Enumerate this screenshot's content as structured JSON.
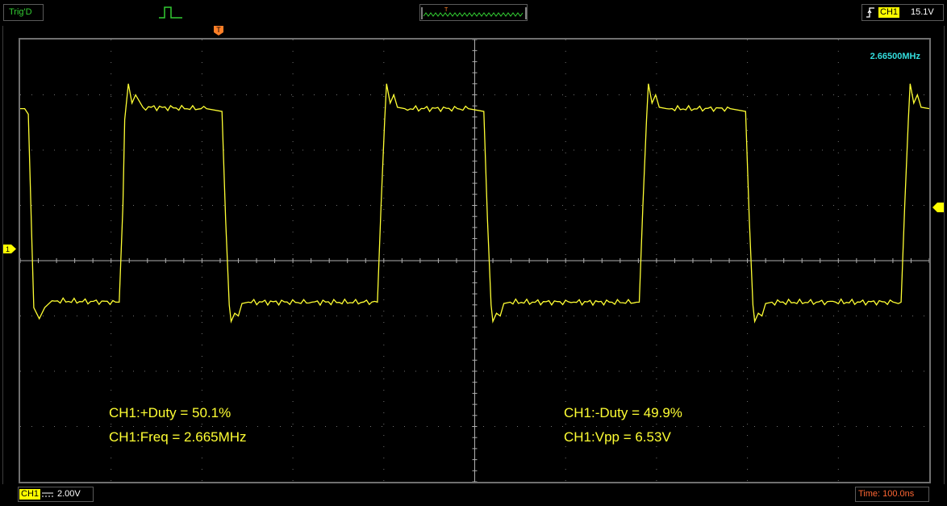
{
  "toolbar": {
    "trigger_status": "Trig'D",
    "trigger_icon": "pulse-trigger-icon",
    "overview_marker": "T",
    "trigger_channel": "CH1",
    "trigger_level": "15.1V",
    "edge_icon": "rising-edge-icon"
  },
  "screen": {
    "trigger_marker": "T",
    "channel_marker": "1",
    "frequency_readout": "2.66500MHz",
    "measurements": {
      "pos_duty": "CH1:+Duty = 50.1%",
      "freq": "CH1:Freq = 2.665MHz",
      "neg_duty": "CH1:-Duty = 49.9%",
      "vpp": "CH1:Vpp = 6.53V"
    }
  },
  "status": {
    "channel": "CH1",
    "volts_per_div": "2.00V",
    "coupling_icon": "dc-coupling-icon",
    "timebase": "Time: 100.0ns"
  },
  "colors": {
    "trace": "#ffff33",
    "grid": "#707070",
    "trigger_marker": "#ff7f27",
    "frequency": "#33dddd",
    "timebase": "#ff6633",
    "trig_status": "#33cc33"
  },
  "chart_data": {
    "type": "line",
    "x_units": "ns",
    "y_units": "V",
    "grid": true,
    "x_divisions": 10,
    "y_divisions": 8,
    "xlim": [
      -105,
      895
    ],
    "ylim": [
      -6.5,
      9.5
    ],
    "series": [
      {
        "values_note_free": true,
        "x": [
          -105,
          -100,
          -96,
          -92,
          -90,
          -84,
          -78,
          -70,
          0,
          4,
          8,
          10,
          14,
          18,
          22,
          30,
          100,
          117,
          121,
          125,
          127,
          131,
          135,
          139,
          146,
          216,
          288,
          292,
          296,
          298,
          302,
          306,
          310,
          318,
          388,
          405,
          409,
          413,
          415,
          419,
          423,
          427,
          434,
          504,
          576,
          580,
          584,
          586,
          590,
          594,
          598,
          606,
          676,
          693,
          697,
          701,
          703,
          707,
          711,
          715,
          722,
          792,
          864,
          868,
          872,
          874,
          878,
          882,
          886,
          895
        ],
        "y": [
          7.0,
          7.0,
          6.8,
          2.0,
          -0.2,
          -0.6,
          -0.2,
          0.05,
          0.0,
          0.0,
          3.5,
          6.6,
          7.9,
          7.2,
          7.5,
          7.05,
          7.0,
          6.9,
          3.0,
          -0.1,
          -0.7,
          -0.4,
          -0.5,
          -0.05,
          0.0,
          0.0,
          0.0,
          3.5,
          6.6,
          7.9,
          7.2,
          7.5,
          7.05,
          7.0,
          7.0,
          6.9,
          3.0,
          -0.1,
          -0.7,
          -0.4,
          -0.5,
          -0.05,
          0.0,
          0.0,
          0.0,
          3.5,
          6.6,
          7.9,
          7.2,
          7.5,
          7.05,
          7.0,
          7.0,
          6.9,
          3.0,
          -0.1,
          -0.7,
          -0.4,
          -0.5,
          -0.05,
          0.0,
          0.0,
          0.0,
          3.5,
          6.6,
          7.9,
          7.2,
          7.5,
          7.05,
          7.0
        ]
      }
    ]
  }
}
